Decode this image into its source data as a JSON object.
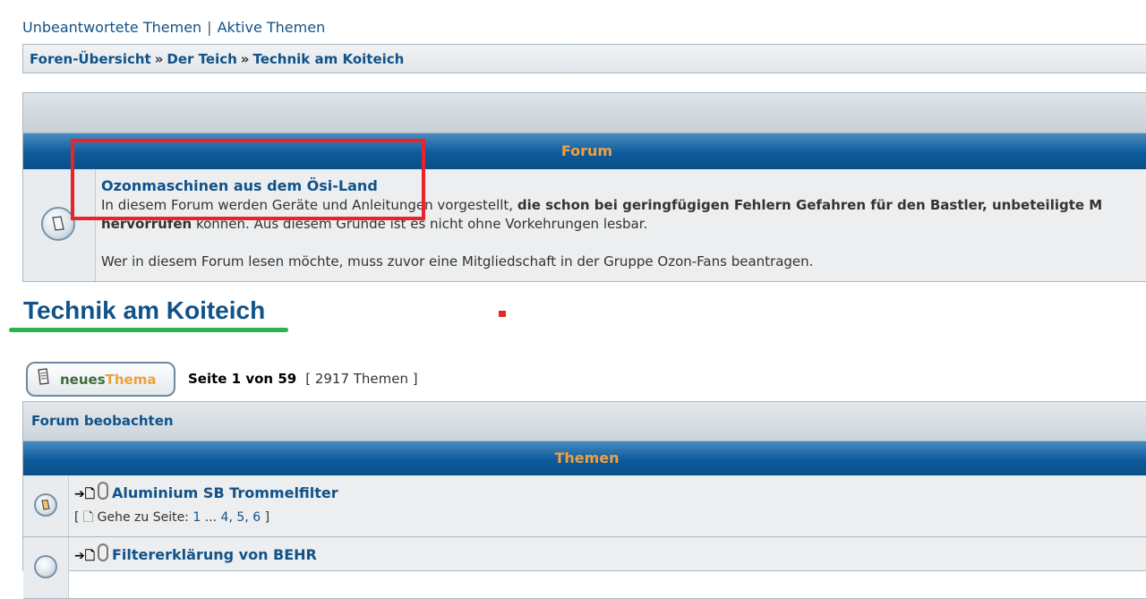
{
  "toplinks": {
    "unanswered": "Unbeantwortete Themen",
    "separator": "|",
    "active": "Aktive Themen"
  },
  "breadcrumb": {
    "items": [
      "Foren-Übersicht",
      "Der Teich",
      "Technik am Koiteich"
    ],
    "separator": "»"
  },
  "forum_table": {
    "header": "Forum",
    "forum": {
      "title": "Ozonmaschinen aus dem Ösi-Land",
      "desc_plain": "In diesem Forum werden Geräte und Anleitungen vorgestellt, ",
      "desc_bold": "die schon bei geringfügigen Fehlern Gefahren für den Bastler, unbeteiligte M",
      "desc_line2_bold": "hervorrufen",
      "desc_line2": " können. Aus diesem Grunde ist es nicht ohne Vorkehrungen lesbar.",
      "desc_line3": "Wer in diesem Forum lesen möchte, muss zuvor eine Mitgliedschaft in der Gruppe Ozon-Fans beantragen.",
      "icon": "forum-read-icon"
    }
  },
  "page_title": "Technik am Koiteich",
  "new_topic_button": {
    "word1": "neues",
    "word2": "Thema",
    "icon": "document-icon"
  },
  "pagination": {
    "page_text": "Seite 1 von 59",
    "count_text": "[ 2917 Themen ]"
  },
  "topic_table": {
    "watch_label": "Forum beobachten",
    "header": "Themen",
    "topics": [
      {
        "marks": "➔🗋",
        "title": "Aluminium SB Trommelfilter",
        "goto_label": "[ 🗋 Gehe zu Seite:",
        "pages": [
          "1",
          "...",
          "4",
          "5",
          "6"
        ],
        "goto_end": "]"
      },
      {
        "marks": "➔🗋",
        "title": "Filtererklärung von BEHR",
        "goto_label": "",
        "pages": [],
        "goto_end": ""
      }
    ]
  },
  "colors": {
    "link": "#105289",
    "header_blue": "#0c5b9b",
    "header_text": "#f0a040",
    "annotation_red": "#e8242a",
    "annotation_green": "#2bb24c"
  }
}
